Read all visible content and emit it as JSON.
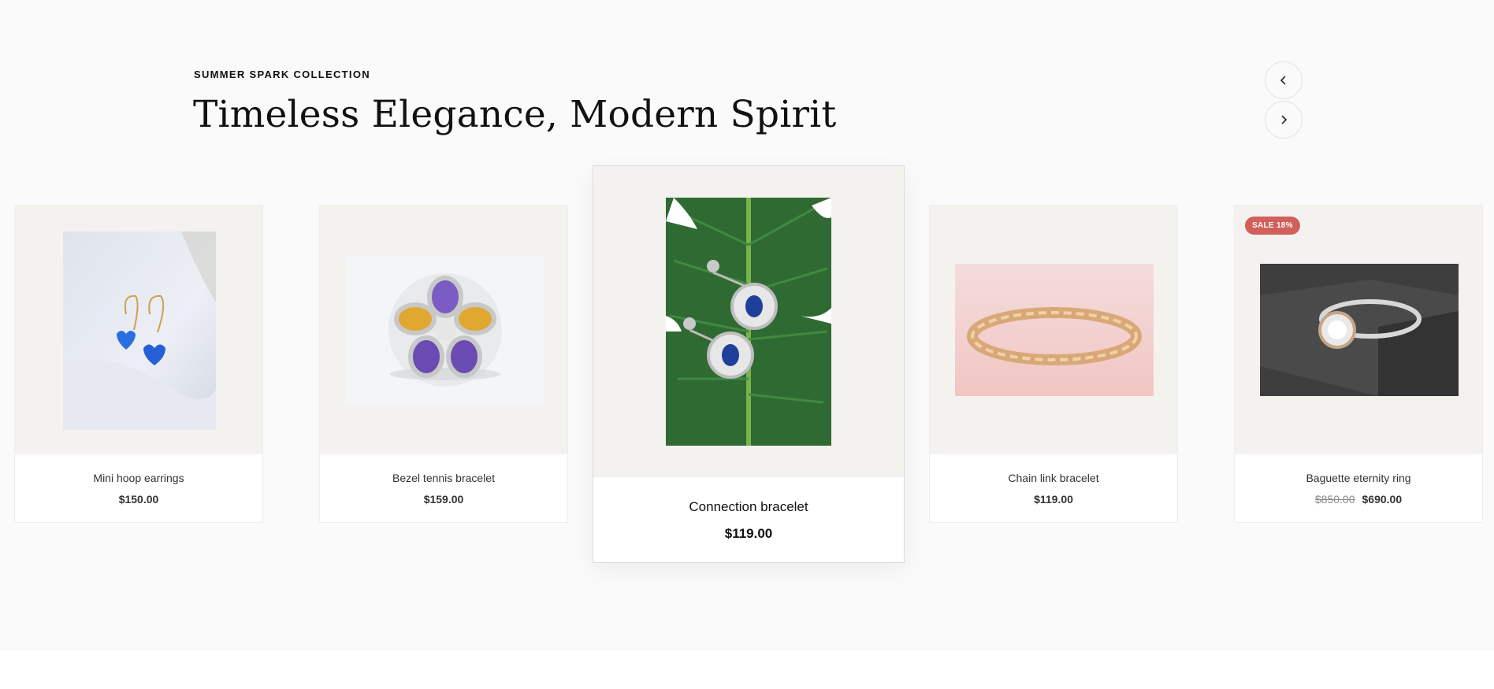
{
  "section": {
    "eyebrow": "SUMMER SPARK COLLECTION",
    "heading": "Timeless Elegance, Modern Spirit"
  },
  "nav": {
    "prev_icon": "chevron-left-icon",
    "next_icon": "chevron-right-icon"
  },
  "products": [
    {
      "name": "Mini hoop earrings",
      "price": "$150.00"
    },
    {
      "name": "Bezel tennis bracelet",
      "price": "$159.00"
    },
    {
      "name": "Connection bracelet",
      "price": "$119.00"
    },
    {
      "name": "Chain link bracelet",
      "price": "$119.00"
    },
    {
      "name": "Baguette eternity ring",
      "compare_price": "$850.00",
      "price": "$690.00",
      "badge": "SALE 18%"
    }
  ],
  "colors": {
    "background": "#fafafa",
    "card_media": "#f4f2ef",
    "sale_badge": "#d1605b",
    "text": "#111111"
  }
}
